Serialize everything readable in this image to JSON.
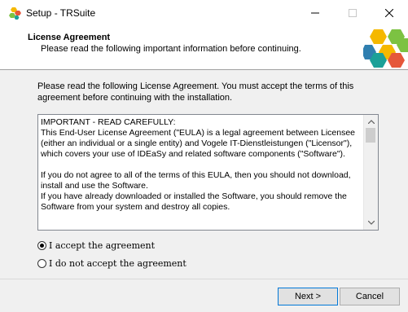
{
  "window": {
    "title": "Setup - TRSuite",
    "icon": "installer-icon"
  },
  "header": {
    "title": "License Agreement",
    "subtitle": "Please read the following important information before continuing.",
    "logo": "hexagon-logo"
  },
  "intro": "Please read the following License Agreement. You must accept the terms of this agreement before continuing with the installation.",
  "license_text": "IMPORTANT - READ CAREFULLY:\nThis End-User License Agreement (\"EULA) is a legal agreement between Licensee (either an individual or a single entity) and Vogele IT-Dienstleistungen (\"Licensor\"), which covers your use of IDEaSy and related software components (\"Software\").\n\nIf you do not agree to all of the terms of this EULA, then you should not download, install and use the Software.\nIf you have already downloaded or installed the Software, you should remove the Software from your system and destroy all copies.",
  "options": {
    "accept": "I accept the agreement",
    "decline": "I do not accept the agreement",
    "selected": "accept"
  },
  "buttons": {
    "next": "Next >",
    "cancel": "Cancel"
  },
  "colors": {
    "accent_border": "#0078d7",
    "logo_yellow": "#f5b800",
    "logo_green": "#7cc242",
    "logo_teal": "#1ba098",
    "logo_red": "#e5573a",
    "logo_blue": "#2f7fb0"
  }
}
